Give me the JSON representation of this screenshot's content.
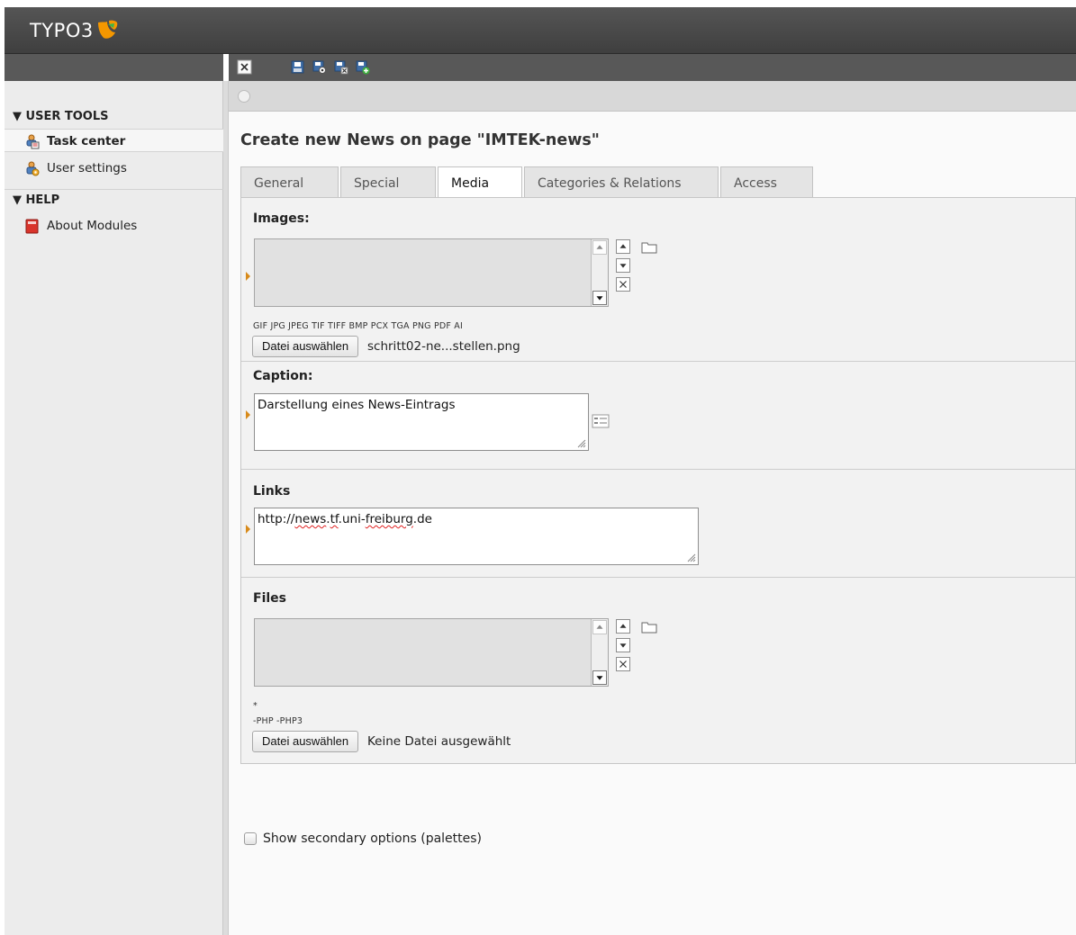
{
  "header": {
    "logo_text": "TYPO3"
  },
  "sidebar": {
    "groups": [
      {
        "title": "▼ USER TOOLS",
        "items": [
          {
            "label": "Task center",
            "icon": "task-center-icon"
          },
          {
            "label": "User settings",
            "icon": "user-settings-icon"
          }
        ]
      },
      {
        "title": "▼ HELP",
        "items": [
          {
            "label": "About Modules",
            "icon": "about-modules-icon"
          }
        ]
      }
    ]
  },
  "toolbar": {
    "buttons": [
      "close-icon",
      "save-icon",
      "save-and-view-icon",
      "save-and-close-icon",
      "save-and-new-icon"
    ]
  },
  "page": {
    "title": "Create new News on page \"IMTEK-news\"",
    "tabs": [
      "General",
      "Special",
      "Media",
      "Categories & Relations",
      "Access"
    ],
    "active_tab": "Media"
  },
  "images": {
    "label": "Images:",
    "extensions": "GIF JPG JPEG TIF TIFF BMP PCX TGA PNG PDF AI",
    "file_button": "Datei auswählen",
    "file_name": "schritt02-ne...stellen.png"
  },
  "caption": {
    "label": "Caption:",
    "value": "Darstellung eines News-Eintrags"
  },
  "links": {
    "label": "Links",
    "value_parts": [
      "http://",
      "news",
      ".",
      "tf",
      ".uni-",
      "freiburg",
      ".de"
    ]
  },
  "files": {
    "label": "Files",
    "allowed": "*",
    "disallowed": "-PHP -PHP3",
    "file_button": "Datei auswählen",
    "file_name": "Keine Datei ausgewählt"
  },
  "secondary_options": {
    "label": "Show secondary options (palettes)",
    "checked": false
  },
  "colors": {
    "header_bg": "#4a4a4a",
    "accent_orange": "#f49700",
    "marker": "#d88a1a"
  }
}
